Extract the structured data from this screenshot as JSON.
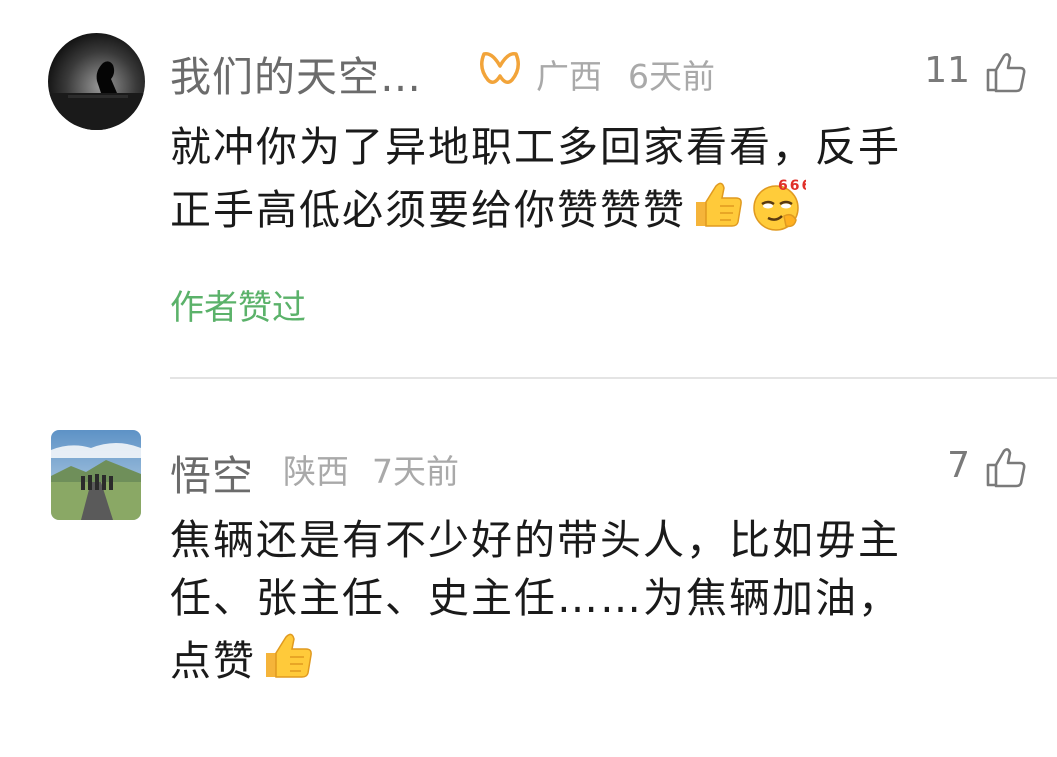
{
  "comments": [
    {
      "username": "我们的天空…",
      "location": "广西",
      "time": "6天前",
      "likes": "11",
      "text_line1": "就冲你为了异地职工多回家看看，反手",
      "text_line2": "正手高低必须要给你赞赞赞",
      "emojis": [
        "thumbs-up-emoji",
        "666-smirk-emoji"
      ],
      "author_liked": "作者赞过"
    },
    {
      "username": "悟空",
      "location": "陕西",
      "time": "7天前",
      "likes": "7",
      "text_line1": "焦辆还是有不少好的带头人，比如毋主",
      "text_line2": "任、张主任、史主任……为焦辆加油，",
      "text_line3": "点赞",
      "emojis": [
        "thumbs-up-emoji"
      ]
    }
  ],
  "emoji_666_label": "666",
  "colors": {
    "username": "#6b6b6b",
    "meta": "#a9a9a9",
    "author_liked": "#5bb26a",
    "badge": "#f2a43a"
  }
}
